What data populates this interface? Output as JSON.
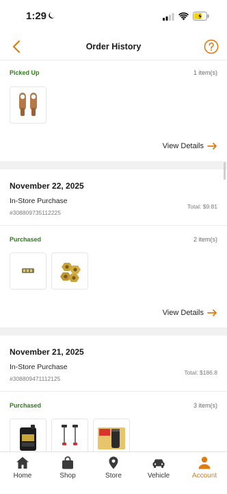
{
  "status_bar": {
    "time": "1:29"
  },
  "header": {
    "title": "Order History"
  },
  "orders": [
    {
      "status": "Picked Up",
      "item_count": "1 item(s)",
      "view_details": "View Details"
    },
    {
      "date": "November 22, 2025",
      "type": "In-Store Purchase",
      "order_number": "#308809735112225",
      "total": "Total: $9.81",
      "status": "Purchased",
      "item_count": "2 item(s)",
      "view_details": "View Details"
    },
    {
      "date": "November 21, 2025",
      "type": "In-Store Purchase",
      "order_number": "#308809471112125",
      "total": "Total: $186.8",
      "status": "Purchased",
      "item_count": "3 item(s)"
    }
  ],
  "tabs": [
    {
      "label": "Home",
      "icon": "home-icon"
    },
    {
      "label": "Shop",
      "icon": "bag-icon"
    },
    {
      "label": "Store",
      "icon": "location-pin-icon"
    },
    {
      "label": "Vehicle",
      "icon": "car-icon"
    },
    {
      "label": "Account",
      "icon": "person-icon",
      "active": true
    }
  ],
  "colors": {
    "accent": "#e07b11",
    "status_green": "#2e7d1b",
    "section_gap": "#f1f1f1"
  }
}
